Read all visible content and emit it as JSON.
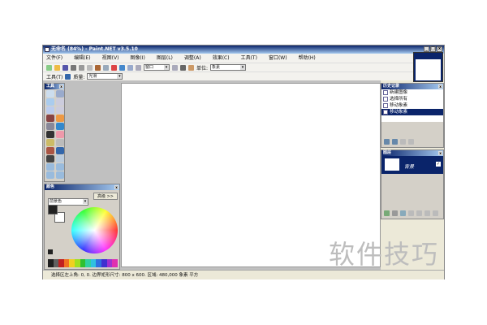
{
  "window": {
    "title": "无命名 (84%) - Paint.NET v3.5.10",
    "min": "_",
    "max": "□",
    "close": "x"
  },
  "menu": [
    "文件(F)",
    "编辑(E)",
    "视图(V)",
    "图像(I)",
    "图层(L)",
    "调整(A)",
    "效果(C)",
    "工具(T)",
    "窗口(W)",
    "帮助(H)"
  ],
  "toolbar": {
    "zoom_value": "窗口",
    "units_label": "单位:",
    "units_value": "象素"
  },
  "toolbar2": {
    "tool_label": "工具(T)",
    "quality_label": "质量:",
    "quality_value": "光滑"
  },
  "tools_panel": {
    "title": "工具"
  },
  "colors_panel": {
    "title": "颜色",
    "mode": "前景色",
    "more_button": "高级 >>"
  },
  "history_panel": {
    "title": "历史记录",
    "items": [
      "新建图像",
      "选择所有",
      "移动象素",
      "移动象素"
    ],
    "selected_index": 3
  },
  "layers_panel": {
    "title": "图层",
    "layers": [
      {
        "name": "背景",
        "visible": true
      }
    ]
  },
  "status": "选择区左上角: 0, 0. 边界矩形尺寸: 800 x 600. 区域: 480,000 象素 平方",
  "watermark": "软件技巧",
  "palette": [
    "#202020",
    "#606060",
    "#c02020",
    "#f07020",
    "#f0d020",
    "#a0e020",
    "#30c030",
    "#30d0a0",
    "#30c0e0",
    "#3070e0",
    "#4030d0",
    "#a030d0",
    "#e030b0"
  ]
}
